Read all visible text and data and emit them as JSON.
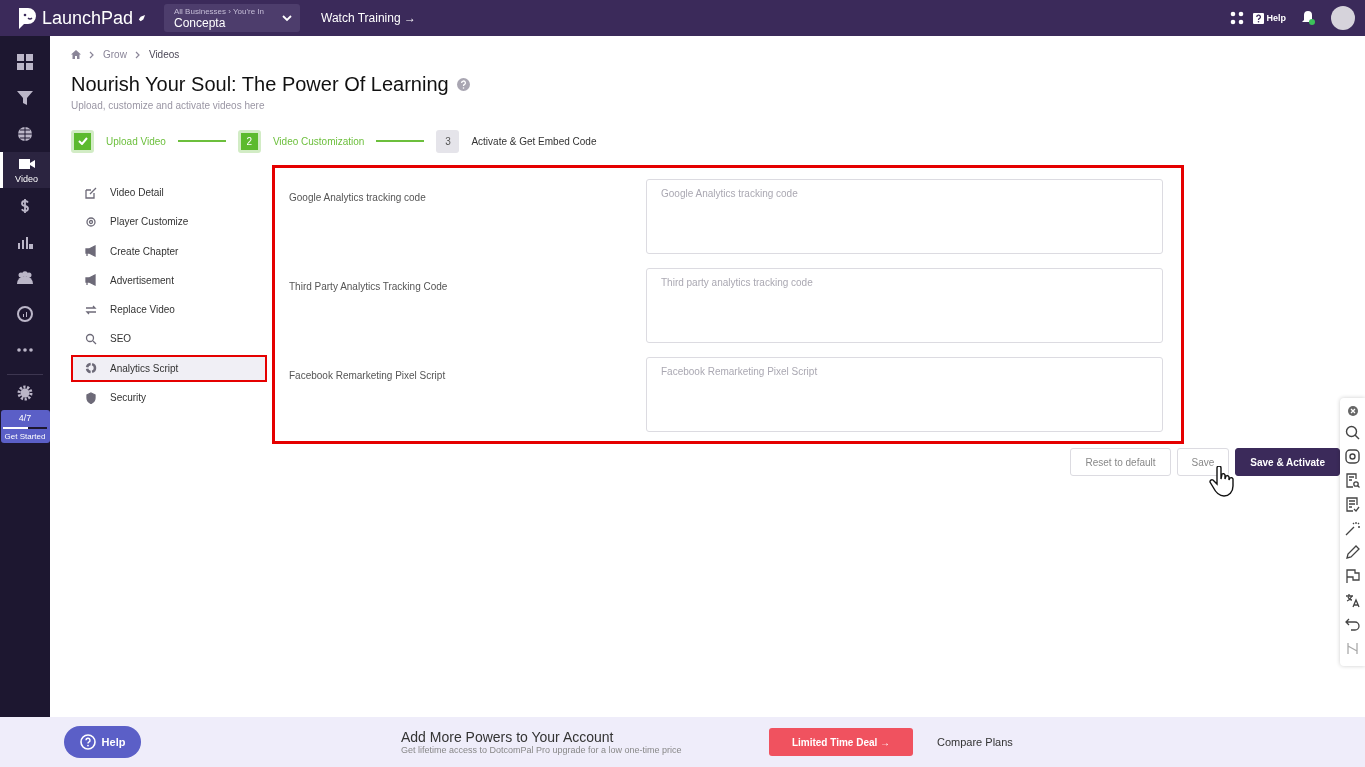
{
  "topbar": {
    "brand": "LaunchPad",
    "business_switcher": {
      "caption": "All Businesses › You're In",
      "value": "Concepta"
    },
    "training_link": "Watch Training →",
    "help": "Help"
  },
  "rail": {
    "items": [
      {
        "selected": false
      },
      {
        "selected": false
      },
      {
        "selected": false
      },
      {
        "label": "Video",
        "selected": true
      },
      {
        "selected": false
      },
      {
        "selected": false
      },
      {
        "selected": false
      },
      {
        "selected": false
      },
      {
        "selected": false
      }
    ],
    "progress": {
      "count": "4/7",
      "level": 0.57,
      "label": "Get Started"
    }
  },
  "breadcrumb": [
    "Grow",
    "Videos"
  ],
  "page": {
    "title": "Nourish Your Soul: The Power Of Learning",
    "subtitle": "Upload, customize and activate videos here"
  },
  "steps": [
    {
      "label": "Upload Video",
      "kind": "done"
    },
    {
      "marker": "2",
      "label": "Video Customization",
      "kind": "active"
    },
    {
      "marker": "3",
      "label": "Activate & Get Embed Code",
      "kind": "pending"
    }
  ],
  "menu": [
    {
      "label": "Video Detail",
      "selected": false,
      "highlighted": false
    },
    {
      "label": "Player Customize",
      "selected": false,
      "highlighted": false
    },
    {
      "label": "Create Chapter",
      "selected": false,
      "highlighted": false
    },
    {
      "label": "Advertisement",
      "selected": false,
      "highlighted": false
    },
    {
      "label": "Replace Video",
      "selected": false,
      "highlighted": false
    },
    {
      "label": "SEO",
      "selected": false,
      "highlighted": false
    },
    {
      "label": "Analytics Script",
      "selected": true,
      "highlighted": true
    },
    {
      "label": "Security",
      "selected": false,
      "highlighted": false
    }
  ],
  "form": {
    "highlighted": true,
    "fields": [
      {
        "label": "Google Analytics tracking code",
        "placeholder": "Google Analytics tracking code"
      },
      {
        "label": "Third Party Analytics Tracking Code",
        "placeholder": "Third party analytics tracking code"
      },
      {
        "label": "Facebook Remarketing Pixel Script",
        "placeholder": "Facebook Remarketing Pixel Script"
      }
    ]
  },
  "actions": [
    {
      "label": "Reset to default",
      "kind": "outline"
    },
    {
      "label": "Save",
      "kind": "outline"
    },
    {
      "label": "Save & Activate",
      "kind": "primary"
    }
  ],
  "footer": {
    "help": "Help",
    "headline": "Add More Powers to Your Account",
    "subline": "Get lifetime access to DotcomPal Pro upgrade for a low one-time price",
    "deal": "Limited Time Deal →",
    "compare": "Compare Plans"
  }
}
